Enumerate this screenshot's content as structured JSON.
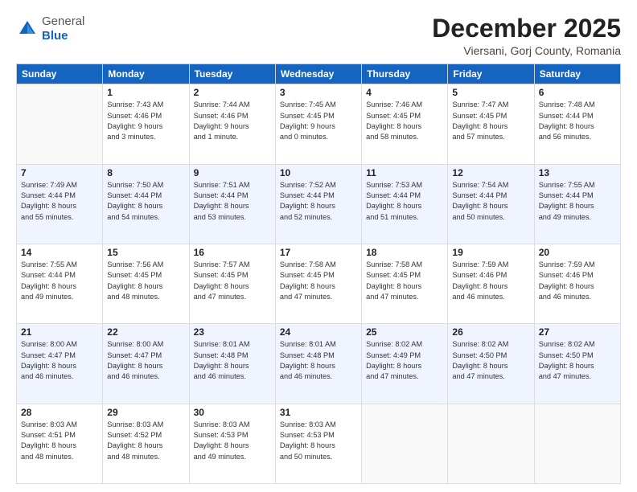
{
  "logo": {
    "general": "General",
    "blue": "Blue"
  },
  "header": {
    "month": "December 2025",
    "location": "Viersani, Gorj County, Romania"
  },
  "weekdays": [
    "Sunday",
    "Monday",
    "Tuesday",
    "Wednesday",
    "Thursday",
    "Friday",
    "Saturday"
  ],
  "weeks": [
    [
      {
        "day": "",
        "info": ""
      },
      {
        "day": "1",
        "info": "Sunrise: 7:43 AM\nSunset: 4:46 PM\nDaylight: 9 hours\nand 3 minutes."
      },
      {
        "day": "2",
        "info": "Sunrise: 7:44 AM\nSunset: 4:46 PM\nDaylight: 9 hours\nand 1 minute."
      },
      {
        "day": "3",
        "info": "Sunrise: 7:45 AM\nSunset: 4:45 PM\nDaylight: 9 hours\nand 0 minutes."
      },
      {
        "day": "4",
        "info": "Sunrise: 7:46 AM\nSunset: 4:45 PM\nDaylight: 8 hours\nand 58 minutes."
      },
      {
        "day": "5",
        "info": "Sunrise: 7:47 AM\nSunset: 4:45 PM\nDaylight: 8 hours\nand 57 minutes."
      },
      {
        "day": "6",
        "info": "Sunrise: 7:48 AM\nSunset: 4:44 PM\nDaylight: 8 hours\nand 56 minutes."
      }
    ],
    [
      {
        "day": "7",
        "info": "Sunrise: 7:49 AM\nSunset: 4:44 PM\nDaylight: 8 hours\nand 55 minutes."
      },
      {
        "day": "8",
        "info": "Sunrise: 7:50 AM\nSunset: 4:44 PM\nDaylight: 8 hours\nand 54 minutes."
      },
      {
        "day": "9",
        "info": "Sunrise: 7:51 AM\nSunset: 4:44 PM\nDaylight: 8 hours\nand 53 minutes."
      },
      {
        "day": "10",
        "info": "Sunrise: 7:52 AM\nSunset: 4:44 PM\nDaylight: 8 hours\nand 52 minutes."
      },
      {
        "day": "11",
        "info": "Sunrise: 7:53 AM\nSunset: 4:44 PM\nDaylight: 8 hours\nand 51 minutes."
      },
      {
        "day": "12",
        "info": "Sunrise: 7:54 AM\nSunset: 4:44 PM\nDaylight: 8 hours\nand 50 minutes."
      },
      {
        "day": "13",
        "info": "Sunrise: 7:55 AM\nSunset: 4:44 PM\nDaylight: 8 hours\nand 49 minutes."
      }
    ],
    [
      {
        "day": "14",
        "info": "Sunrise: 7:55 AM\nSunset: 4:44 PM\nDaylight: 8 hours\nand 49 minutes."
      },
      {
        "day": "15",
        "info": "Sunrise: 7:56 AM\nSunset: 4:45 PM\nDaylight: 8 hours\nand 48 minutes."
      },
      {
        "day": "16",
        "info": "Sunrise: 7:57 AM\nSunset: 4:45 PM\nDaylight: 8 hours\nand 47 minutes."
      },
      {
        "day": "17",
        "info": "Sunrise: 7:58 AM\nSunset: 4:45 PM\nDaylight: 8 hours\nand 47 minutes."
      },
      {
        "day": "18",
        "info": "Sunrise: 7:58 AM\nSunset: 4:45 PM\nDaylight: 8 hours\nand 47 minutes."
      },
      {
        "day": "19",
        "info": "Sunrise: 7:59 AM\nSunset: 4:46 PM\nDaylight: 8 hours\nand 46 minutes."
      },
      {
        "day": "20",
        "info": "Sunrise: 7:59 AM\nSunset: 4:46 PM\nDaylight: 8 hours\nand 46 minutes."
      }
    ],
    [
      {
        "day": "21",
        "info": "Sunrise: 8:00 AM\nSunset: 4:47 PM\nDaylight: 8 hours\nand 46 minutes."
      },
      {
        "day": "22",
        "info": "Sunrise: 8:00 AM\nSunset: 4:47 PM\nDaylight: 8 hours\nand 46 minutes."
      },
      {
        "day": "23",
        "info": "Sunrise: 8:01 AM\nSunset: 4:48 PM\nDaylight: 8 hours\nand 46 minutes."
      },
      {
        "day": "24",
        "info": "Sunrise: 8:01 AM\nSunset: 4:48 PM\nDaylight: 8 hours\nand 46 minutes."
      },
      {
        "day": "25",
        "info": "Sunrise: 8:02 AM\nSunset: 4:49 PM\nDaylight: 8 hours\nand 47 minutes."
      },
      {
        "day": "26",
        "info": "Sunrise: 8:02 AM\nSunset: 4:50 PM\nDaylight: 8 hours\nand 47 minutes."
      },
      {
        "day": "27",
        "info": "Sunrise: 8:02 AM\nSunset: 4:50 PM\nDaylight: 8 hours\nand 47 minutes."
      }
    ],
    [
      {
        "day": "28",
        "info": "Sunrise: 8:03 AM\nSunset: 4:51 PM\nDaylight: 8 hours\nand 48 minutes."
      },
      {
        "day": "29",
        "info": "Sunrise: 8:03 AM\nSunset: 4:52 PM\nDaylight: 8 hours\nand 48 minutes."
      },
      {
        "day": "30",
        "info": "Sunrise: 8:03 AM\nSunset: 4:53 PM\nDaylight: 8 hours\nand 49 minutes."
      },
      {
        "day": "31",
        "info": "Sunrise: 8:03 AM\nSunset: 4:53 PM\nDaylight: 8 hours\nand 50 minutes."
      },
      {
        "day": "",
        "info": ""
      },
      {
        "day": "",
        "info": ""
      },
      {
        "day": "",
        "info": ""
      }
    ]
  ]
}
